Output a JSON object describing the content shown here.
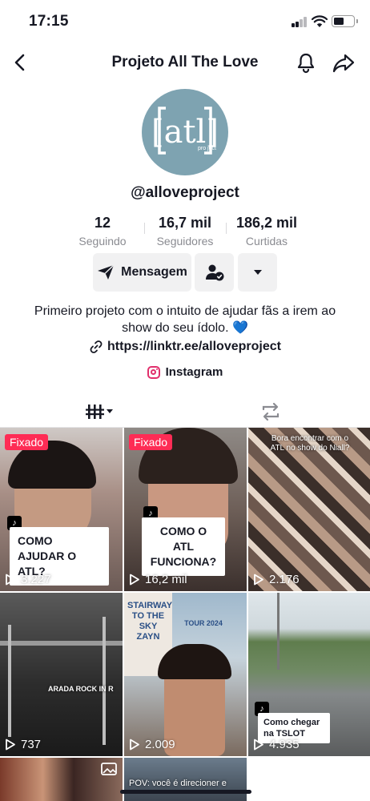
{
  "status_bar": {
    "time": "17:15"
  },
  "nav": {
    "title": "Projeto All The Love"
  },
  "profile": {
    "username": "@alloveproject",
    "avatar_text": "[atl]",
    "avatar_sub": "pro ject",
    "stats": [
      {
        "value": "12",
        "label": "Seguindo"
      },
      {
        "value": "16,7 mil",
        "label": "Seguidores"
      },
      {
        "value": "186,2 mil",
        "label": "Curtidas"
      }
    ],
    "message_button": "Mensagem",
    "bio": "Primeiro projeto com o intuito de ajudar fãs a irem ao show do seu ídolo. 💙",
    "link": "https://linktr.ee/alloveproject",
    "instagram": "Instagram"
  },
  "videos": [
    {
      "pinned": "Fixado",
      "caption": "COMO AJUDAR O ATL?",
      "views": "3.227"
    },
    {
      "pinned": "Fixado",
      "caption": "COMO O ATL FUNCIONA?",
      "views": "16,2 mil"
    },
    {
      "overlay": "Bora encontrar com o ATL no show do Niall?",
      "views": "2.176"
    },
    {
      "overlay": "ARADA ROCK IN R",
      "views": "737"
    },
    {
      "overlay": "STAIRWAY TO THE SKY ZAYN",
      "overlay_sub": "TOUR 2024",
      "views": "2.009"
    },
    {
      "caption": "Como chegar na TSLOT",
      "views": "4.935"
    },
    {
      "overlay": ""
    },
    {
      "overlay": "POV: você é direcioner e"
    }
  ],
  "colors": {
    "pinned": "#fe2c55",
    "accent_text": "#161823",
    "muted": "#8a8b91",
    "avatar_bg": "#7ea3b1"
  }
}
